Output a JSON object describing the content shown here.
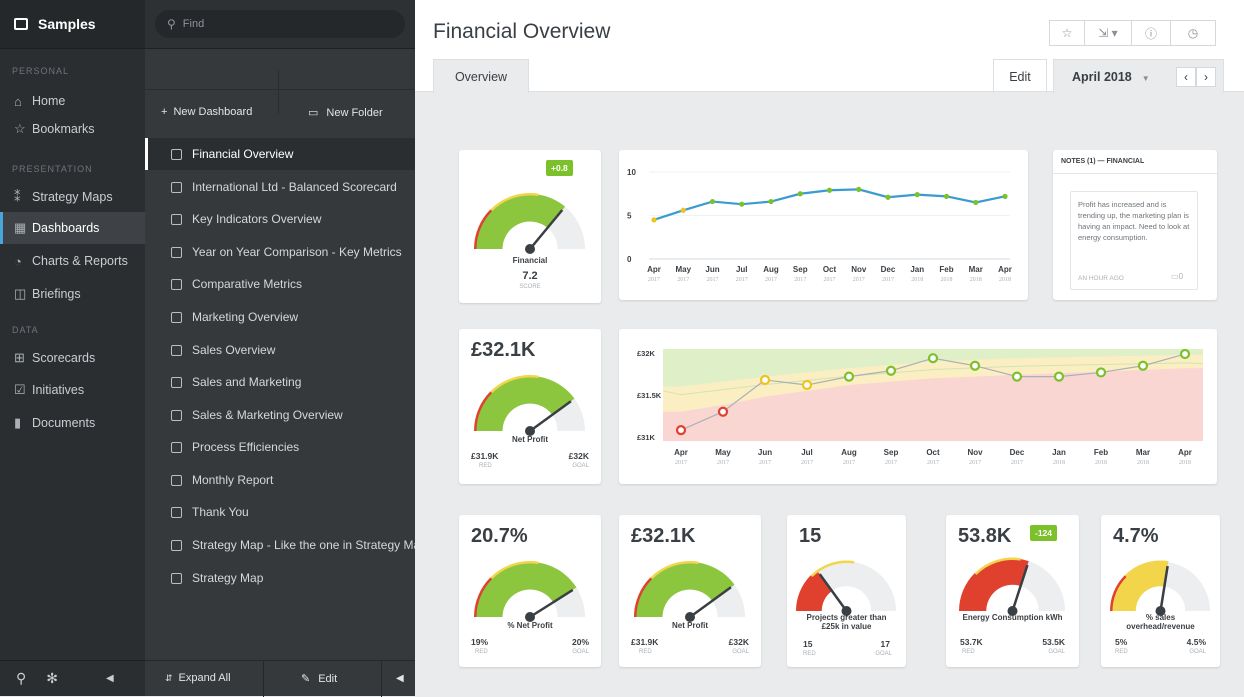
{
  "nav": {
    "title": "Samples",
    "sections": [
      "PERSONAL",
      "PRESENTATION",
      "DATA"
    ],
    "items": [
      {
        "label": "Home",
        "icon": "home-icon"
      },
      {
        "label": "Bookmarks",
        "icon": "star-icon"
      },
      {
        "label": "Strategy Maps",
        "icon": "strategy-map-icon"
      },
      {
        "label": "Dashboards",
        "icon": "dashboard-icon"
      },
      {
        "label": "Charts & Reports",
        "icon": "pie-chart-icon"
      },
      {
        "label": "Briefings",
        "icon": "book-icon"
      },
      {
        "label": "Scorecards",
        "icon": "scorecard-icon"
      },
      {
        "label": "Initiatives",
        "icon": "checkbox-icon"
      },
      {
        "label": "Documents",
        "icon": "document-icon"
      }
    ],
    "collapse_glyph": "‹"
  },
  "list": {
    "search_placeholder": "Find",
    "new_dashboard": "New Dashboard",
    "new_folder": "New Folder",
    "items": [
      "Financial Overview",
      "International Ltd - Balanced Scorecard",
      "Key Indicators Overview",
      "Year on Year Comparison - Key Metrics",
      "Comparative Metrics",
      "Marketing Overview",
      "Sales Overview",
      "Sales and Marketing",
      "Sales & Marketing Overview",
      "Process Efficiencies",
      "Monthly Report",
      "Thank You",
      "Strategy Map - Like the one in Strategy Maps",
      "Strategy Map"
    ],
    "expand_all": "Expand All",
    "edit": "Edit"
  },
  "main": {
    "title": "Financial Overview",
    "tab": "Overview",
    "edit_button": "Edit",
    "period": "April 2018",
    "toolbar_icons": [
      "star-icon",
      "export-icon",
      "info-icon",
      "clock-icon"
    ]
  },
  "financial_gauge": {
    "badge": "+0.8",
    "name": "Financial",
    "value": "7.2",
    "value_label": "SCORE",
    "fill": 0.72
  },
  "line_chart": {
    "y_ticks": [
      "10",
      "5",
      "0"
    ],
    "months": [
      "Apr",
      "May",
      "Jun",
      "Jul",
      "Aug",
      "Sep",
      "Oct",
      "Nov",
      "Dec",
      "Jan",
      "Feb",
      "Mar",
      "Apr"
    ],
    "years": [
      "2017",
      "2017",
      "2017",
      "2017",
      "2017",
      "2017",
      "2017",
      "2017",
      "2017",
      "2018",
      "2018",
      "2018",
      "2018"
    ]
  },
  "chart_data": [
    {
      "type": "line",
      "x": [
        "Apr 2017",
        "May 2017",
        "Jun 2017",
        "Jul 2017",
        "Aug 2017",
        "Sep 2017",
        "Oct 2017",
        "Nov 2017",
        "Dec 2017",
        "Jan 2018",
        "Feb 2018",
        "Mar 2018",
        "Apr 2018"
      ],
      "values": [
        4.5,
        5.6,
        6.6,
        6.3,
        6.6,
        7.5,
        7.9,
        8.0,
        7.1,
        7.4,
        7.2,
        6.5,
        7.2
      ],
      "ylim": [
        0,
        10
      ],
      "yticks": [
        0,
        5,
        10
      ],
      "line_color": "#3a9bd0",
      "point_colors": [
        "#f0c21d",
        "#f0c21d",
        "#7cc12b",
        "#7cc12b",
        "#7cc12b",
        "#7cc12b",
        "#7cc12b",
        "#7cc12b",
        "#7cc12b",
        "#7cc12b",
        "#7cc12b",
        "#7cc12b",
        "#7cc12b"
      ]
    },
    {
      "type": "area",
      "x": [
        "Apr 2017",
        "May 2017",
        "Jun 2017",
        "Jul 2017",
        "Aug 2017",
        "Sep 2017",
        "Oct 2017",
        "Nov 2017",
        "Dec 2017",
        "Jan 2018",
        "Feb 2018",
        "Mar 2018",
        "Apr 2018"
      ],
      "values": [
        31.08,
        31.3,
        31.68,
        31.62,
        31.72,
        31.79,
        31.94,
        31.85,
        31.72,
        31.72,
        31.77,
        31.85,
        31.99
      ],
      "ylim": [
        30.95,
        32.05
      ],
      "yticks_labels": [
        "£32K",
        "£31.5K",
        "£31K"
      ],
      "yticks": [
        32,
        31.5,
        31
      ],
      "point_colors": [
        "#e0412e",
        "#e0412e",
        "#f0c21d",
        "#f0c21d",
        "#7cc12b",
        "#7cc12b",
        "#7cc12b",
        "#7cc12b",
        "#7cc12b",
        "#7cc12b",
        "#7cc12b",
        "#7cc12b",
        "#7cc12b"
      ]
    }
  ],
  "notes": {
    "title": "NOTES (1) — FINANCIAL",
    "text": "Profit has increased and is trending up, the marketing plan is having an impact. Need to look at energy consumption.",
    "time": "AN HOUR AGO",
    "count": "0"
  },
  "net_profit_main": {
    "value": "£32.1K",
    "name": "Net Profit",
    "red": "£31.9K",
    "red_label": "RED",
    "goal": "£32K",
    "goal_label": "GOAL",
    "fill": 0.8
  },
  "gauges": [
    {
      "value": "20.7%",
      "name": "% Net Profit",
      "red": "19%",
      "red_label": "RED",
      "goal": "20%",
      "goal_label": "GOAL",
      "fill": 0.82,
      "color": "#8cc63e"
    },
    {
      "value": "£32.1K",
      "name": "Net Profit",
      "red": "£31.9K",
      "red_label": "RED",
      "goal": "£32K",
      "goal_label": "GOAL",
      "fill": 0.8,
      "color": "#8cc63e"
    },
    {
      "value": "15",
      "name": "Projects greater than £25k in value",
      "red": "15",
      "red_label": "RED",
      "goal": "17",
      "goal_label": "GOAL",
      "fill": 0.3,
      "color": "#e0412e"
    },
    {
      "value": "53.8K",
      "badge": "-124",
      "name": "Energy Consumption kWh",
      "red": "53.7K",
      "red_label": "RED",
      "goal": "53.5K",
      "goal_label": "GOAL",
      "fill": 0.6,
      "color": "#e0412e"
    },
    {
      "value": "4.7%",
      "name": "% sales overhead/revenue",
      "red": "5%",
      "red_label": "RED",
      "goal": "4.5%",
      "goal_label": "GOAL",
      "fill": 0.55,
      "color": "#f2d54a"
    }
  ]
}
